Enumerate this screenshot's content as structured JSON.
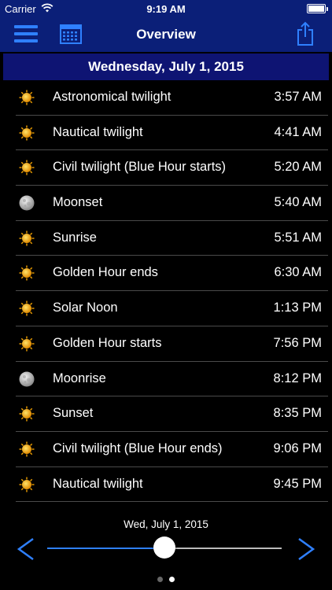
{
  "status_bar": {
    "carrier": "Carrier",
    "time": "9:19 AM",
    "battery_level": 1.0
  },
  "nav": {
    "title": "Overview",
    "menu_icon": "hamburger-menu-icon",
    "calendar_icon": "calendar-icon",
    "share_icon": "share-icon",
    "accent_color": "#2f80ff",
    "bar_color": "#0b1f78"
  },
  "date_header": "Wednesday, July 1, 2015",
  "events": [
    {
      "icon": "sun",
      "label": "Astronomical twilight",
      "time": "3:57 AM"
    },
    {
      "icon": "sun",
      "label": "Nautical twilight",
      "time": "4:41 AM"
    },
    {
      "icon": "sun",
      "label": "Civil twilight (Blue Hour starts)",
      "time": "5:20 AM"
    },
    {
      "icon": "moon",
      "label": "Moonset",
      "time": "5:40 AM"
    },
    {
      "icon": "sun",
      "label": "Sunrise",
      "time": "5:51 AM"
    },
    {
      "icon": "sun",
      "label": "Golden Hour ends",
      "time": "6:30 AM"
    },
    {
      "icon": "sun",
      "label": "Solar Noon",
      "time": "1:13 PM"
    },
    {
      "icon": "sun",
      "label": "Golden Hour starts",
      "time": "7:56 PM"
    },
    {
      "icon": "moon",
      "label": "Moonrise",
      "time": "8:12 PM"
    },
    {
      "icon": "sun",
      "label": "Sunset",
      "time": "8:35 PM"
    },
    {
      "icon": "sun",
      "label": "Civil twilight (Blue Hour ends)",
      "time": "9:06 PM"
    },
    {
      "icon": "sun",
      "label": "Nautical twilight",
      "time": "9:45 PM"
    }
  ],
  "bottom": {
    "date_label": "Wed, July 1, 2015",
    "slider_value": 0.5,
    "prev_icon": "chevron-left-icon",
    "next_icon": "chevron-right-icon",
    "pages": 2,
    "current_page": 2
  }
}
